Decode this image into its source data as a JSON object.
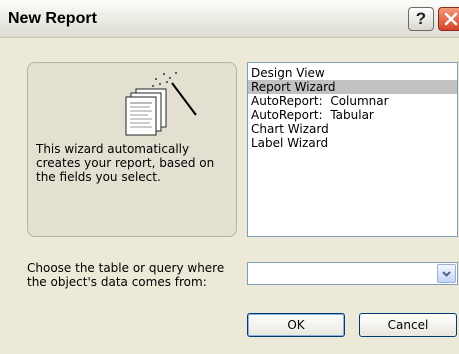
{
  "window": {
    "title": "New Report"
  },
  "titlebar": {
    "help_label": "?"
  },
  "wizard_panel": {
    "description": "This wizard automatically\ncreates your report, based on\nthe fields you select."
  },
  "options": {
    "items": [
      {
        "label": "Design View",
        "selected": false
      },
      {
        "label": "Report Wizard",
        "selected": true
      },
      {
        "label": "AutoReport:  Columnar",
        "selected": false
      },
      {
        "label": "AutoReport:  Tabular",
        "selected": false
      },
      {
        "label": "Chart Wizard",
        "selected": false
      },
      {
        "label": "Label Wizard",
        "selected": false
      }
    ]
  },
  "source": {
    "label": "Choose the table or query where\nthe object's data comes from:",
    "value": ""
  },
  "buttons": {
    "ok": "OK",
    "cancel": "Cancel"
  },
  "colors": {
    "selection": "#c1c1c1",
    "dialog_bg": "#ece9d8",
    "close_red": "#d6432a"
  }
}
